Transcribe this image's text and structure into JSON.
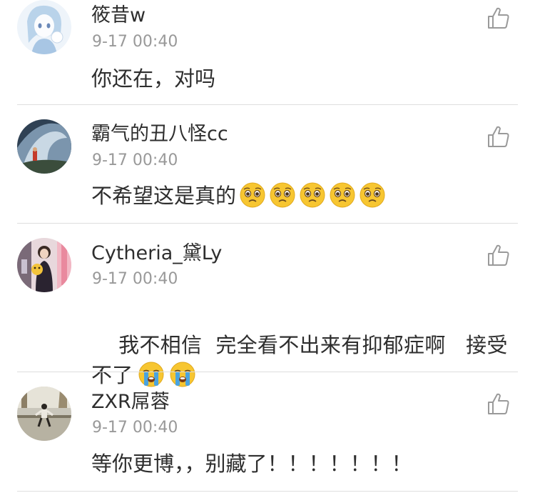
{
  "comments": [
    {
      "username": "筱昔w",
      "timestamp": "9-17 00:40",
      "text": "你还在，对吗",
      "emojis": [],
      "avatar_icon": "anime-girl-avatar-icon"
    },
    {
      "username": "霸气的丑八怪cc",
      "timestamp": "9-17 00:40",
      "text": "不希望这是真的",
      "emojis": [
        "pleading-face",
        "pleading-face",
        "pleading-face",
        "pleading-face",
        "pleading-face"
      ],
      "avatar_icon": "wave-scene-avatar-icon"
    },
    {
      "username": "Cytheria_黛Ly",
      "timestamp": "9-17 00:40",
      "text": "我不相信  完全看不出来有抑郁症啊   接受不了",
      "emojis": [
        "loudly-crying-face",
        "loudly-crying-face"
      ],
      "avatar_icon": "photo-avatar-icon"
    },
    {
      "username": "ZXR屌蓉",
      "timestamp": "9-17 00:40",
      "text": "等你更博，，别藏了！！！！！！！",
      "emojis": [],
      "avatar_icon": "street-photo-avatar-icon"
    }
  ],
  "like_icon": "thumbs-up-icon",
  "colors": {
    "username": "#2e2e2e",
    "timestamp": "#999999",
    "divider": "#dedede",
    "emoji_yellow": "#f7c631",
    "tear_blue": "#4aa3df"
  }
}
